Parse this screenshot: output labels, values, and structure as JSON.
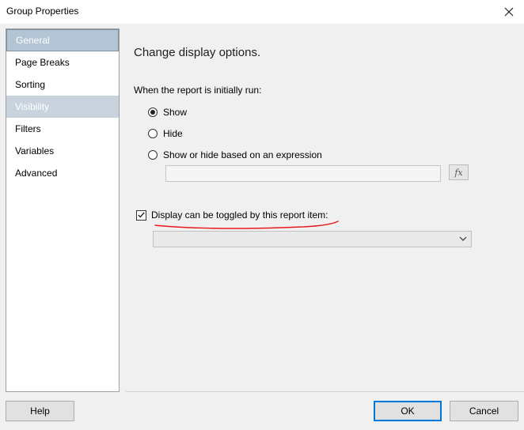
{
  "window": {
    "title": "Group Properties"
  },
  "nav": {
    "items": [
      {
        "label": "General",
        "state": "selected"
      },
      {
        "label": "Page Breaks",
        "state": "normal"
      },
      {
        "label": "Sorting",
        "state": "normal"
      },
      {
        "label": "Visibility",
        "state": "hover"
      },
      {
        "label": "Filters",
        "state": "normal"
      },
      {
        "label": "Variables",
        "state": "normal"
      },
      {
        "label": "Advanced",
        "state": "normal"
      }
    ]
  },
  "content": {
    "heading": "Change display options.",
    "when_label": "When the report is initially run:",
    "options": [
      {
        "label": "Show",
        "checked": true
      },
      {
        "label": "Hide",
        "checked": false
      },
      {
        "label": "Show or hide based on an expression",
        "checked": false
      }
    ],
    "expression_value": "",
    "fx_label": "fx",
    "toggle_checkbox": {
      "label": "Display can be toggled by this report item:",
      "checked": true
    },
    "toggle_select_value": ""
  },
  "buttons": {
    "help": "Help",
    "ok": "OK",
    "cancel": "Cancel"
  },
  "colors": {
    "annotation": "#e8191c",
    "accent": "#0078d7"
  }
}
